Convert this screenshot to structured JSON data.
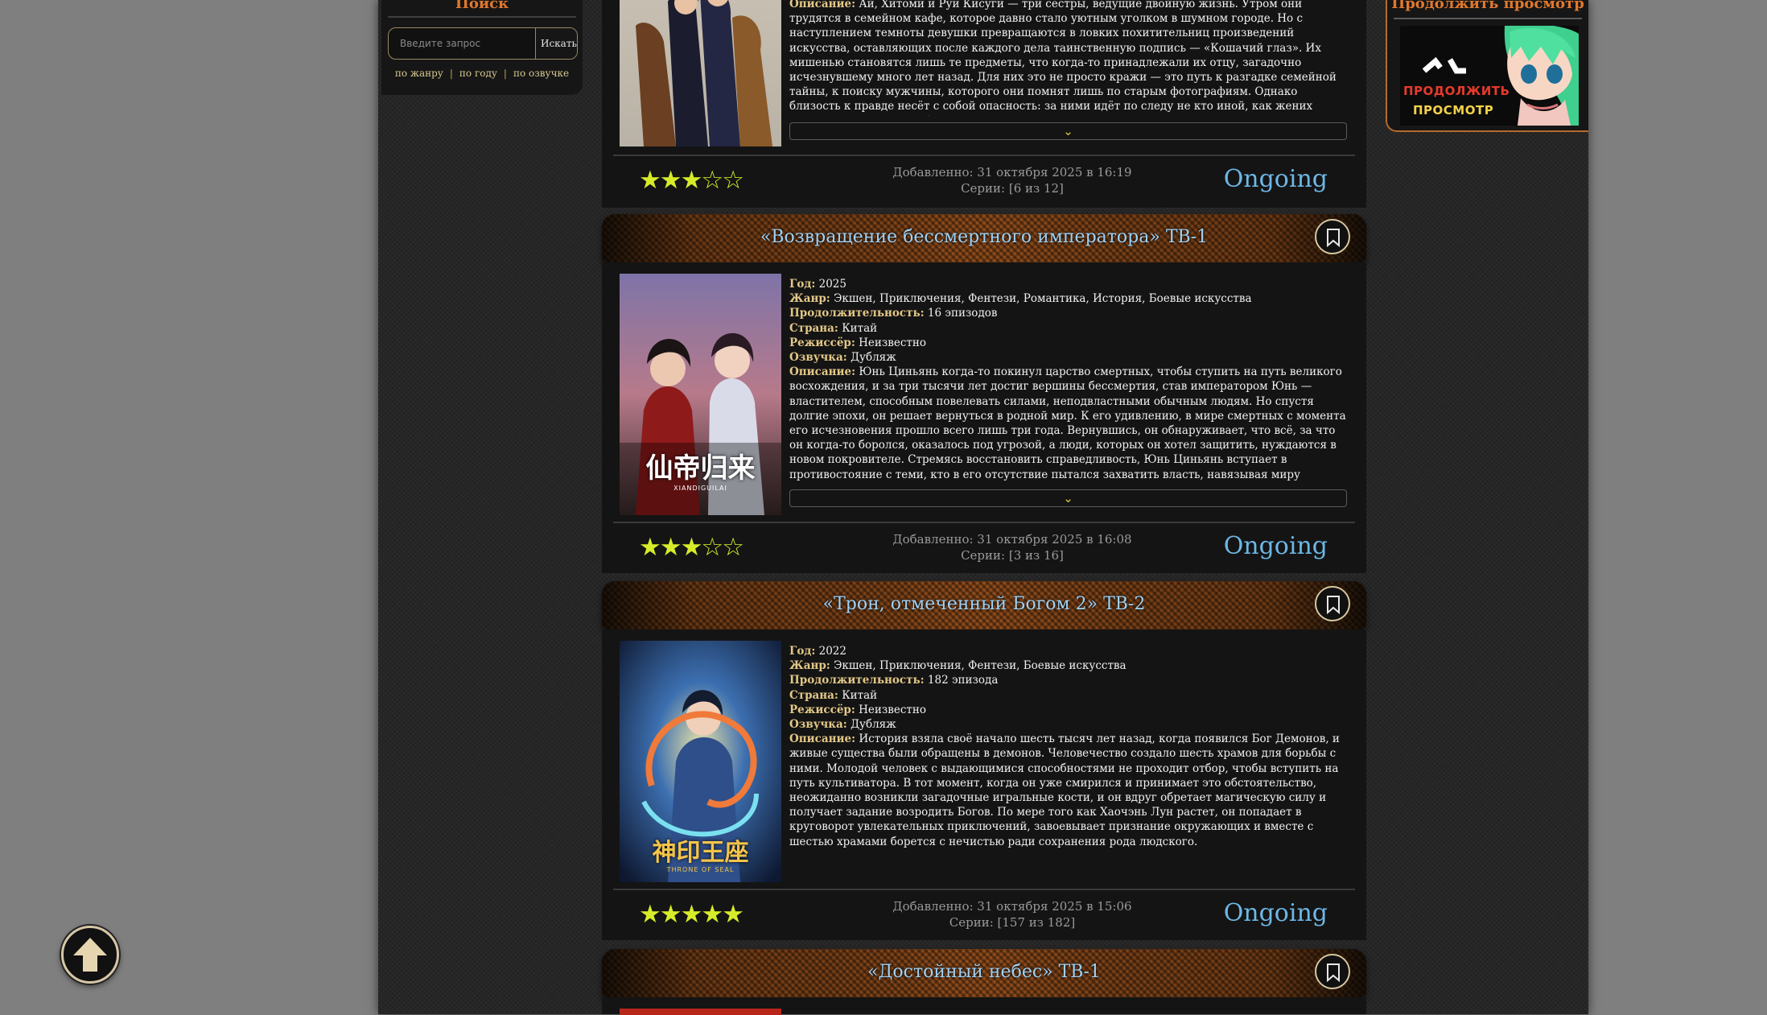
{
  "search": {
    "title": "Поиск",
    "placeholder": "Введите запрос",
    "button": "Искать",
    "filters": [
      "по жанру",
      "по году",
      "по озвучке"
    ]
  },
  "continue_panel": {
    "title": "Продолжить просмотр",
    "banner_line1": "ПРОДОЛЖИТЬ",
    "banner_line2": "ПРОСМОТР"
  },
  "labels": {
    "year": "Год:",
    "genre": "Жанр:",
    "duration": "Продолжительность:",
    "country": "Страна:",
    "director": "Режиссёр:",
    "dub": "Озвучка:",
    "desc": "Описание:"
  },
  "cards": [
    {
      "description": "Ай, Хитоми и Руи Кисуги — три сестры, ведущие двойную жизнь. Утром они трудятся в семейном кафе, которое давно стало уютным уголком в шумном городе. Но с наступлением темноты девушки превращаются в ловких похитительниц произведений искусства, оставляющих после каждого дела таинственную подпись — «Кошачий глаз». Их мишенью становятся лишь те предметы, что когда-то принадлежали их отцу, загадочно исчезнувшему много лет назад. Для них это не просто кражи — это путь к разгадке семейной тайны, к поиску мужчины, которого они помнят лишь по старым фотографиям. Однако близость к правде несёт с собой опасность: за ними идёт по следу не кто иной, как жених Хитоми — Тосно. Он работает детективом и, не зная о",
      "rating": 3,
      "added": "Добавленно: 31 октября 2025 в 16:19",
      "episodes": "Серии: [6 из 12]",
      "status": "Ongoing"
    },
    {
      "title": "«Возвращение бессмертного императора» ТВ-1",
      "year": "2025",
      "genre": "Экшен, Приключения, Фентези, Романтика, История, Боевые искусства",
      "duration": "16 эпизодов",
      "country": "Китай",
      "director": "Неизвестно",
      "dub": "Дубляж",
      "description": "Юнь Циньянь когда-то покинул царство смертных, чтобы ступить на путь великого восхождения, и за три тысячи лет достиг вершины бессмертия, став императором Юнь — властителем, способным повелевать силами, неподвластными обычным людям. Но спустя долгие эпохи, он решает вернуться в родной мир. К его удивлению, в мире смертных с момента его исчезновения прошло всего лишь три года. Вернувшись, он обнаруживает, что всё, за что он когда-то боролся, оказалось под угрозой, а люди, которых он хотел защитить, нуждаются в новом покровителе. Стремясь восстановить справедливость, Юнь Циньянь вступает в противостояние с теми, кто в его отсутствие пытался захватить власть, навязывая миру ложные идеалы. Его",
      "poster_text": "仙帝归来",
      "poster_sub": "XIANDIGUILAI",
      "rating": 3,
      "added": "Добавленно: 31 октября 2025 в 16:08",
      "episodes": "Серии: [3 из 16]",
      "status": "Ongoing"
    },
    {
      "title": "«Трон, отмеченный Богом 2» ТВ-2",
      "year": "2022",
      "genre": "Экшен, Приключения, Фентези, Боевые искусства",
      "duration": "182 эпизода",
      "country": "Китай",
      "director": "Неизвестно",
      "dub": "Дубляж",
      "description": "История взяла своё начало шесть тысяч лет назад, когда появился Бог Демонов, и живые существа были обращены в демонов. Человечество создало шесть храмов для борьбы с ними. Молодой человек с выдающимися способностями не проходит отбор, чтобы вступить на путь культиватора. В тот момент, когда он уже смирился и принимает это обстоятельство, неожиданно возникли загадочные игральные кости, и он вдруг обретает магическую силу и получает задание возродить Богов. По мере того как Хаочэнь Лун растет, он попадает в круговорот увлекательных приключений, завоевывает признание окружающих и вместе с шестью храмами борется с нечистью ради сохранения рода людского.",
      "poster_text": "神印王座",
      "poster_sub": "THRONE OF SEAL",
      "rating": 5,
      "added": "Добавленно: 31 октября 2025 в 15:06",
      "episodes": "Серии: [157 из 182]",
      "status": "Ongoing"
    },
    {
      "title": "«Достойный небес» ТВ-1"
    }
  ]
}
